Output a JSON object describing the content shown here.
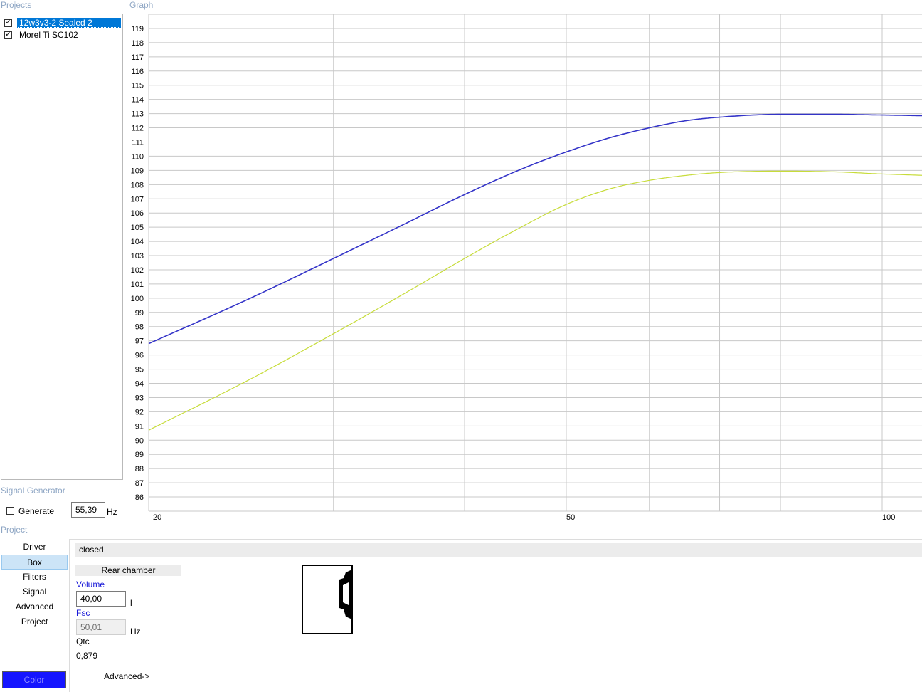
{
  "panels": {
    "projects_title": "Projects",
    "graph_title": "Graph",
    "signal_generator_title": "Signal Generator",
    "project_title": "Project"
  },
  "projects": [
    {
      "label": "12w3v3-2 Sealed 2",
      "checked": true,
      "selected": true
    },
    {
      "label": "Morel Ti SC102",
      "checked": true,
      "selected": false
    }
  ],
  "signal_generator": {
    "generate_label": "Generate",
    "generate_checked": false,
    "frequency_value": "55,39",
    "frequency_unit": "Hz"
  },
  "project_tabs": [
    {
      "label": "Driver",
      "active": false
    },
    {
      "label": "Box",
      "active": true
    },
    {
      "label": "Filters",
      "active": false
    },
    {
      "label": "Signal",
      "active": false
    },
    {
      "label": "Advanced",
      "active": false
    },
    {
      "label": "Project",
      "active": false
    }
  ],
  "color_button": {
    "label": "Color",
    "color": "#1515ff"
  },
  "box": {
    "type": "closed",
    "rear_chamber_label": "Rear chamber",
    "volume_label": "Volume",
    "volume_value": "40,00",
    "volume_unit": "l",
    "fsc_label": "Fsc",
    "fsc_value": "50,01",
    "fsc_unit": "Hz",
    "qtc_label": "Qtc",
    "qtc_value": "0,879",
    "advanced_link": "Advanced->"
  },
  "chart_data": {
    "type": "line",
    "x_scale": "log",
    "xlim": [
      20,
      110
    ],
    "ylim": [
      85,
      120
    ],
    "x_tick_labels": [
      "20",
      "50",
      "100"
    ],
    "y_ticks": [
      86,
      87,
      88,
      89,
      90,
      91,
      92,
      93,
      94,
      95,
      96,
      97,
      98,
      99,
      100,
      101,
      102,
      103,
      104,
      105,
      106,
      107,
      108,
      109,
      110,
      111,
      112,
      113,
      114,
      115,
      116,
      117,
      118,
      119
    ],
    "grid": true,
    "series": [
      {
        "color": "#3434c8",
        "x": [
          20,
          25,
          30,
          35,
          40,
          45,
          50,
          55,
          60,
          65,
          70,
          80,
          90,
          100,
          110
        ],
        "y": [
          96.8,
          100.0,
          102.8,
          105.2,
          107.3,
          109.0,
          110.3,
          111.3,
          112.0,
          112.5,
          112.75,
          112.95,
          112.95,
          112.9,
          112.85
        ]
      },
      {
        "color": "#c7dc3a",
        "x": [
          20,
          25,
          30,
          35,
          40,
          45,
          50,
          55,
          60,
          65,
          70,
          80,
          90,
          100,
          110
        ],
        "y": [
          90.7,
          94.3,
          97.5,
          100.3,
          102.8,
          104.9,
          106.6,
          107.7,
          108.3,
          108.65,
          108.85,
          108.95,
          108.9,
          108.75,
          108.65
        ]
      }
    ]
  }
}
